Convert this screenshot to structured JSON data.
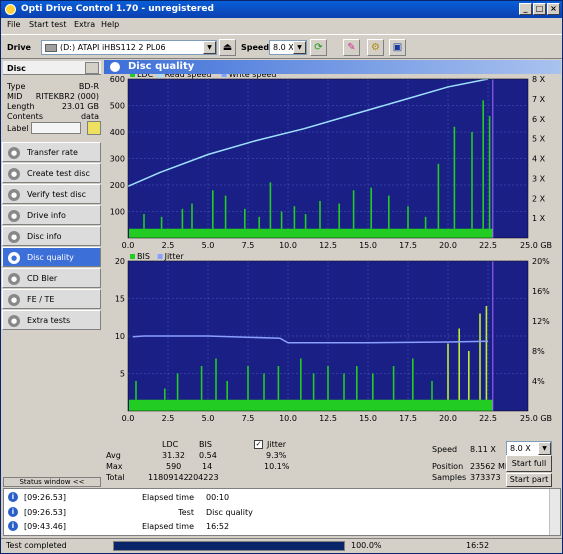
{
  "window": {
    "title": "Opti Drive Control 1.70 - unregistered"
  },
  "menu": [
    "File",
    "Start test",
    "Extra",
    "Help"
  ],
  "toolbar": {
    "drive_label": "Drive",
    "drive_value": "(D:)  ATAPI iHBS112  2 PL06",
    "speed_label": "Speed",
    "speed_value": "8.0 X"
  },
  "disc": {
    "header": "Disc",
    "fields": [
      {
        "k": "Type",
        "v": "BD-R"
      },
      {
        "k": "MID",
        "v": "RITEKBR2 (000)"
      },
      {
        "k": "Length",
        "v": "23.01 GB"
      },
      {
        "k": "Contents",
        "v": "data"
      },
      {
        "k": "Label",
        "v": ""
      }
    ]
  },
  "nav": [
    "Transfer rate",
    "Create test disc",
    "Verify test disc",
    "Drive info",
    "Disc info",
    "Disc quality",
    "CD Bler",
    "FE / TE",
    "Extra tests"
  ],
  "nav_active": 5,
  "status_window_label": "Status window <<",
  "quality": {
    "title": "Disc quality"
  },
  "chart_data": [
    {
      "type": "area",
      "legend": [
        "LDC",
        "Read speed",
        "Write speed"
      ],
      "colors": {
        "ldc": "#22cc22",
        "read": "#9fe0ff",
        "write": "#7fa0ff",
        "bg": "#1a1f86",
        "grid": "#4a58c0",
        "mark": "#aa66ff"
      },
      "xlim": [
        0,
        25
      ],
      "xticks": [
        "0.0",
        "2.5",
        "5.0",
        "7.5",
        "10.0",
        "12.5",
        "15.0",
        "17.5",
        "20.0",
        "22.5",
        "25.0 GB"
      ],
      "ylim": [
        0,
        600
      ],
      "yticks": [
        "100",
        "200",
        "300",
        "400",
        "500",
        "600"
      ],
      "y2ticks": [
        "1 X",
        "2 X",
        "3 X",
        "4 X",
        "5 X",
        "6 X",
        "7 X",
        "8 X"
      ],
      "read_speed": {
        "x": [
          0,
          2,
          5,
          8,
          11,
          14,
          17,
          20,
          22.5
        ],
        "y": [
          2.6,
          3.3,
          4.2,
          4.9,
          5.5,
          6.2,
          6.9,
          7.6,
          8.0
        ]
      },
      "spikes": {
        "x": [
          1.0,
          2.1,
          3.4,
          4.0,
          5.3,
          6.1,
          7.3,
          8.2,
          8.9,
          9.6,
          10.4,
          11.1,
          12.0,
          13.2,
          14.1,
          15.2,
          16.3,
          17.5,
          18.6,
          19.4,
          20.4,
          21.5,
          22.2,
          22.6
        ],
        "y": [
          90,
          80,
          110,
          130,
          180,
          160,
          110,
          80,
          210,
          100,
          120,
          90,
          140,
          130,
          180,
          190,
          160,
          120,
          80,
          280,
          420,
          400,
          520,
          460
        ]
      },
      "baseline": 35
    },
    {
      "type": "area",
      "legend": [
        "BIS",
        "Jitter"
      ],
      "colors": {
        "bis": "#22cc22",
        "bis_hi": "#bbee33",
        "jitter": "#8aa0ff",
        "bg": "#1a1f86",
        "grid": "#4a58c0"
      },
      "xlim": [
        0,
        25
      ],
      "xticks": [
        "0.0",
        "2.5",
        "5.0",
        "7.5",
        "10.0",
        "12.5",
        "15.0",
        "17.5",
        "20.0",
        "22.5",
        "25.0 GB"
      ],
      "ylim": [
        0,
        20
      ],
      "yticks": [
        "5",
        "10",
        "15",
        "20"
      ],
      "y2ticks": [
        "4%",
        "8%",
        "12%",
        "16%",
        "20%"
      ],
      "jitter": {
        "x": [
          0.3,
          1.0,
          5,
          9.5,
          10,
          15,
          20,
          22.5
        ],
        "y": [
          9.9,
          10.0,
          10.0,
          9.7,
          9.1,
          9.1,
          9.2,
          9.3
        ]
      },
      "spikes": {
        "x": [
          0.5,
          2.3,
          3.1,
          4.6,
          5.5,
          6.2,
          7.5,
          8.5,
          9.4,
          10.8,
          11.6,
          12.5,
          13.5,
          14.3,
          15.3,
          16.6,
          17.8,
          19.0,
          20.0,
          20.7,
          21.3,
          22.0,
          22.4
        ],
        "y": [
          4,
          3,
          5,
          6,
          7,
          4,
          6,
          5,
          6,
          7,
          5,
          6,
          5,
          6,
          5,
          6,
          7,
          4,
          9,
          11,
          8,
          13,
          14
        ]
      },
      "baseline": 1.5
    }
  ],
  "stats": {
    "col_ldc": "LDC",
    "col_bis": "BIS",
    "jitter_label": "Jitter",
    "avg_label": "Avg",
    "max_label": "Max",
    "total_label": "Total",
    "avg_ldc": "31.32",
    "avg_bis": "0.54",
    "avg_jitter": "9.3%",
    "max_ldc": "590",
    "max_bis": "14",
    "max_jitter": "10.1%",
    "total_ldc": "11809142",
    "total_bis": "204223",
    "speed_label": "Speed",
    "speed_value": "8.11 X",
    "speed_select": "8.0 X",
    "position_label": "Position",
    "position_value": "23562 MB",
    "samples_label": "Samples",
    "samples_value": "373373",
    "start_full": "Start full",
    "start_part": "Start part"
  },
  "log": [
    {
      "time": "[09:26.53]",
      "k": "Elapsed time",
      "v": "00:10"
    },
    {
      "time": "[09:26.53]",
      "k": "Test",
      "v": "Disc quality"
    },
    {
      "time": "[09:43.46]",
      "k": "Elapsed time",
      "v": "16:52"
    }
  ],
  "statusbar": {
    "text": "Test completed",
    "progress": 100,
    "progress_label": "100.0%",
    "time": "16:52"
  }
}
